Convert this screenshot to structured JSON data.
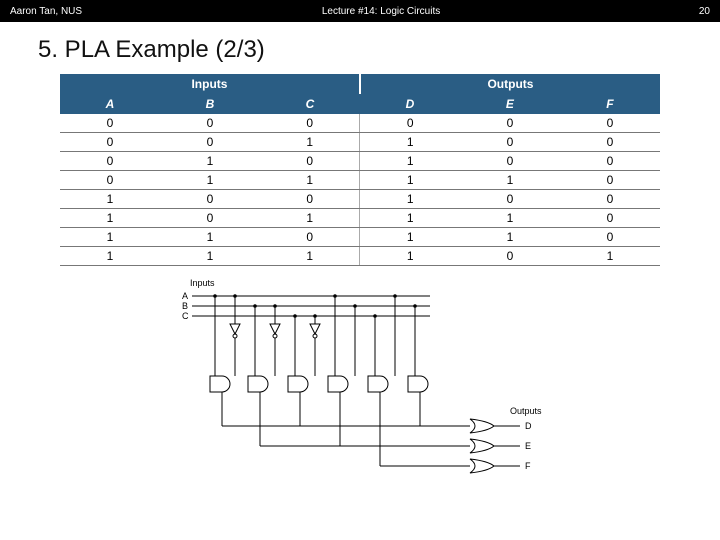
{
  "header": {
    "left": "Aaron Tan, NUS",
    "center": "Lecture #14: Logic Circuits",
    "page": "20"
  },
  "title": "5. PLA Example (2/3)",
  "table": {
    "band_inputs": "Inputs",
    "band_outputs": "Outputs",
    "cols": [
      "A",
      "B",
      "C",
      "D",
      "E",
      "F"
    ],
    "rows": [
      [
        "0",
        "0",
        "0",
        "0",
        "0",
        "0"
      ],
      [
        "0",
        "0",
        "1",
        "1",
        "0",
        "0"
      ],
      [
        "0",
        "1",
        "0",
        "1",
        "0",
        "0"
      ],
      [
        "0",
        "1",
        "1",
        "1",
        "1",
        "0"
      ],
      [
        "1",
        "0",
        "0",
        "1",
        "0",
        "0"
      ],
      [
        "1",
        "0",
        "1",
        "1",
        "1",
        "0"
      ],
      [
        "1",
        "1",
        "0",
        "1",
        "1",
        "0"
      ],
      [
        "1",
        "1",
        "1",
        "1",
        "0",
        "1"
      ]
    ]
  },
  "diagram": {
    "inputs_label": "Inputs",
    "outputs_label": "Outputs",
    "in_signals": [
      "A",
      "B",
      "C"
    ],
    "out_signals": [
      "D",
      "E",
      "F"
    ]
  }
}
